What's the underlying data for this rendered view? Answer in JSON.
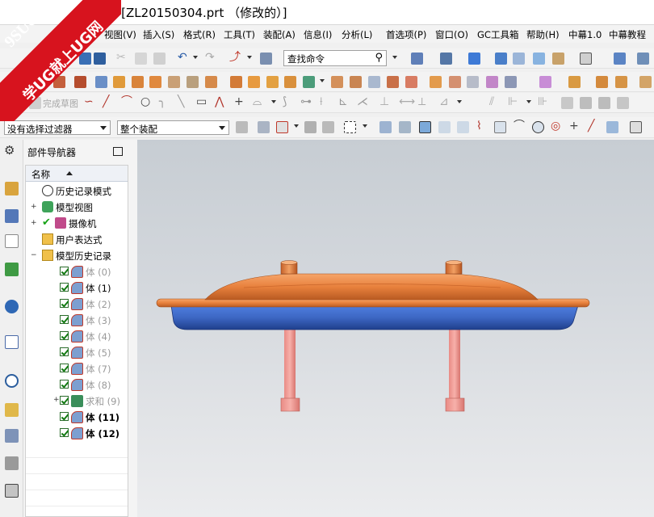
{
  "window": {
    "title": "- [ZL20150304.prt （修改的）]"
  },
  "watermark": {
    "brand": "9SUG",
    "slogan": "学UG就上UG网"
  },
  "menubar": {
    "items": [
      "视图(V)",
      "插入(S)",
      "格式(R)",
      "工具(T)",
      "装配(A)",
      "信息(I)",
      "分析(L)",
      "首选项(P)",
      "窗口(O)",
      "GC工具箱",
      "帮助(H)",
      "中幕1.0",
      "中幕教程"
    ]
  },
  "toolbar": {
    "command_search": "查找命令",
    "sketch_finish": "完成草图"
  },
  "selection_bar": {
    "filter": "没有选择过滤器",
    "scope": "整个装配"
  },
  "navigator": {
    "title": "部件导航器",
    "column_name": "名称",
    "nodes": {
      "history_mode": "历史记录模式",
      "model_views": "模型视图",
      "cameras": "摄像机",
      "user_expressions": "用户表达式",
      "model_history": "模型历史记录"
    },
    "features": [
      {
        "label": "体 (0)",
        "state": "greyed"
      },
      {
        "label": "体 (1)",
        "state": "normal"
      },
      {
        "label": "体 (2)",
        "state": "greyed"
      },
      {
        "label": "体 (3)",
        "state": "greyed"
      },
      {
        "label": "体 (4)",
        "state": "greyed"
      },
      {
        "label": "体 (5)",
        "state": "greyed"
      },
      {
        "label": "体 (7)",
        "state": "greyed"
      },
      {
        "label": "体 (8)",
        "state": "greyed"
      },
      {
        "label": "求和 (9)",
        "state": "greyed"
      },
      {
        "label": "体 (11)",
        "state": "bold"
      },
      {
        "label": "体 (12)",
        "state": "bold"
      }
    ]
  },
  "colors": {
    "orange_lid": "#e8813d",
    "blue_base": "#3d67c4",
    "pink_post": "#f4a19b",
    "accent_red": "#d7131e"
  }
}
